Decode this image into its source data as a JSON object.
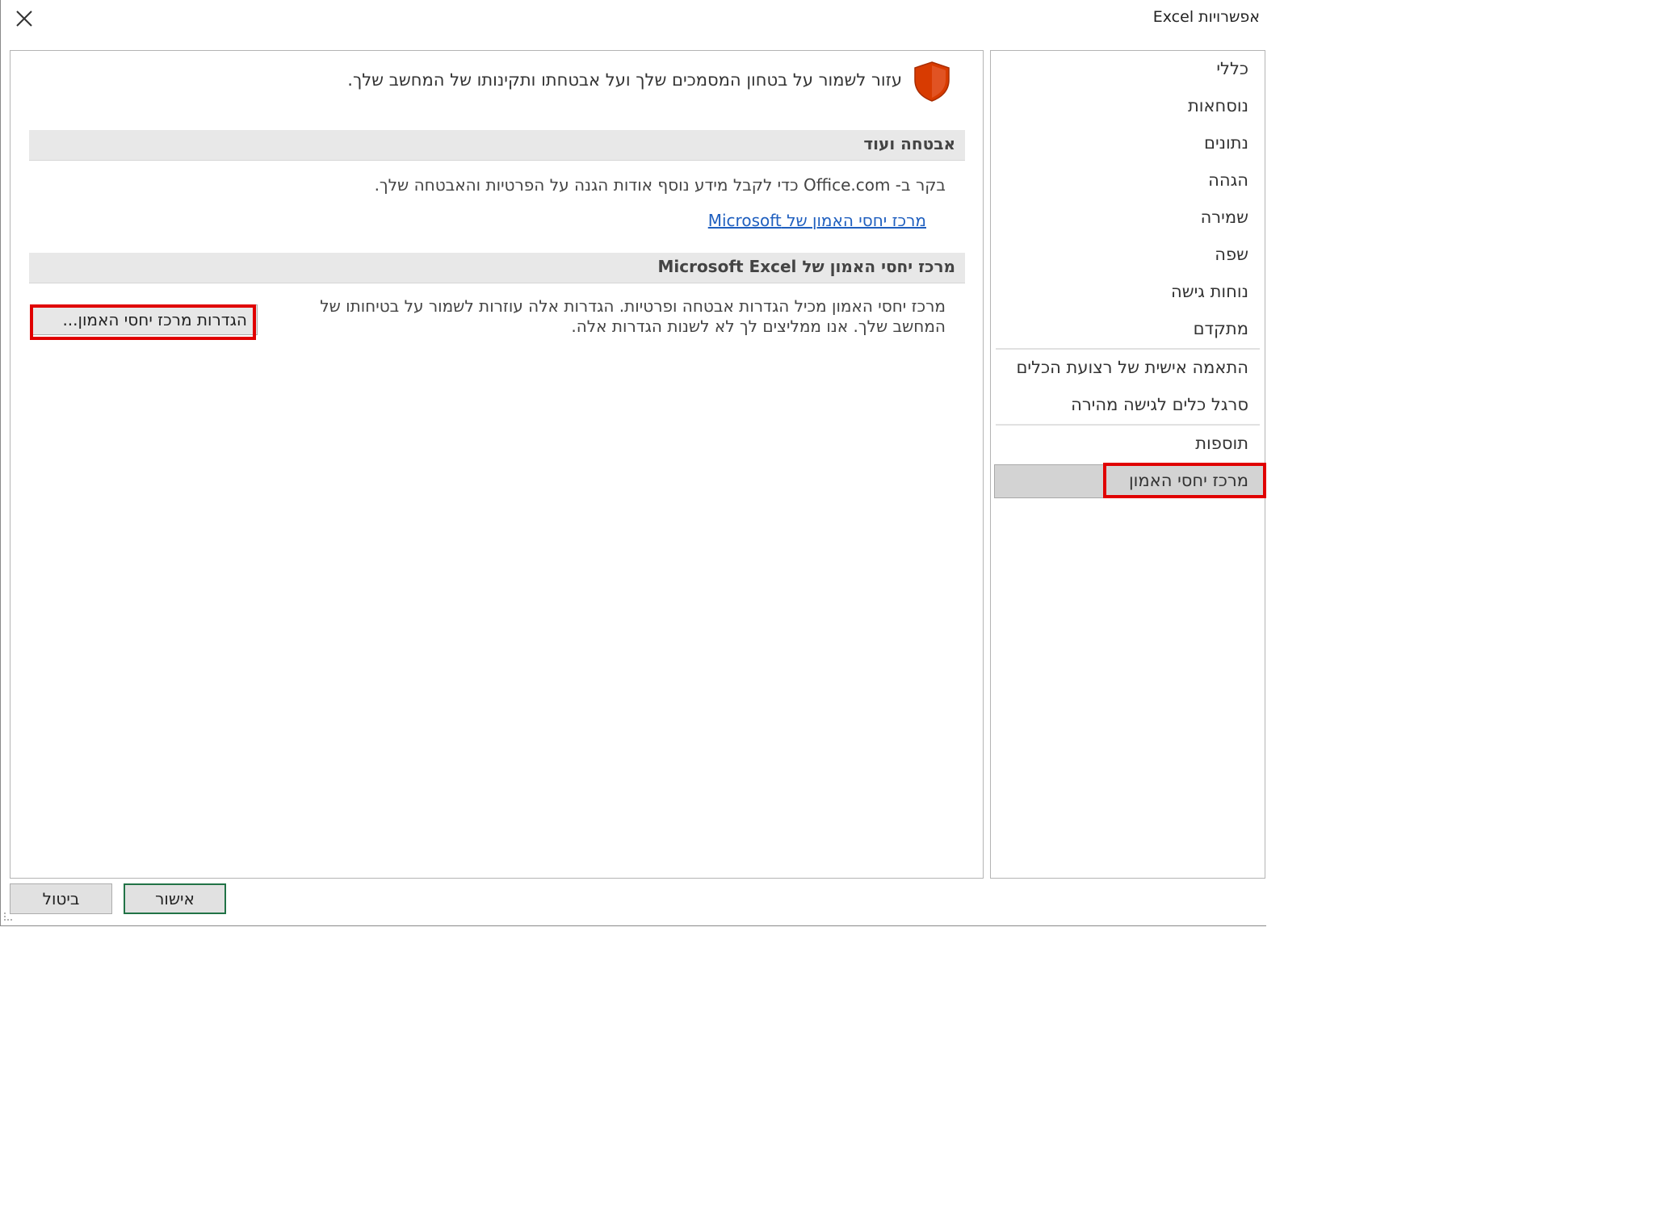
{
  "window": {
    "title": "אפשרויות Excel"
  },
  "sidebar": {
    "items": [
      {
        "label": "כללי"
      },
      {
        "label": "נוסחאות"
      },
      {
        "label": "נתונים"
      },
      {
        "label": "הגהה"
      },
      {
        "label": "שמירה"
      },
      {
        "label": "שפה"
      },
      {
        "label": "נוחות גישה"
      },
      {
        "label": "מתקדם"
      },
      {
        "label": "התאמה אישית של רצועת הכלים"
      },
      {
        "label": "סרגל כלים לגישה מהירה"
      },
      {
        "label": "תוספות"
      },
      {
        "label": "מרכז יחסי האמון",
        "selected": true
      }
    ]
  },
  "main": {
    "intro": "עזור לשמור על בטחון המסמכים שלך ועל אבטחתו ותקינותו של המחשב שלך.",
    "section1": {
      "header": "אבטחה ועוד",
      "text": "בקר ב- Office.com כדי לקבל מידע נוסף אודות הגנה על הפרטיות והאבטחה שלך.",
      "link": "מרכז יחסי האמון של Microsoft"
    },
    "section2": {
      "header": "מרכז יחסי האמון של Microsoft Excel",
      "text": "מרכז יחסי האמון מכיל הגדרות אבטחה ופרטיות. הגדרות אלה עוזרות לשמור על בטיחותו של המחשב שלך. אנו ממליצים לך לא לשנות הגדרות אלה.",
      "button": "הגדרות מרכז יחסי האמון..."
    }
  },
  "footer": {
    "ok_label": "אישור",
    "cancel_label": "ביטול"
  },
  "colors": {
    "highlight": "#e00000",
    "link": "#1f5fbf",
    "ok_border": "#217346",
    "shield": "#d83b01"
  }
}
